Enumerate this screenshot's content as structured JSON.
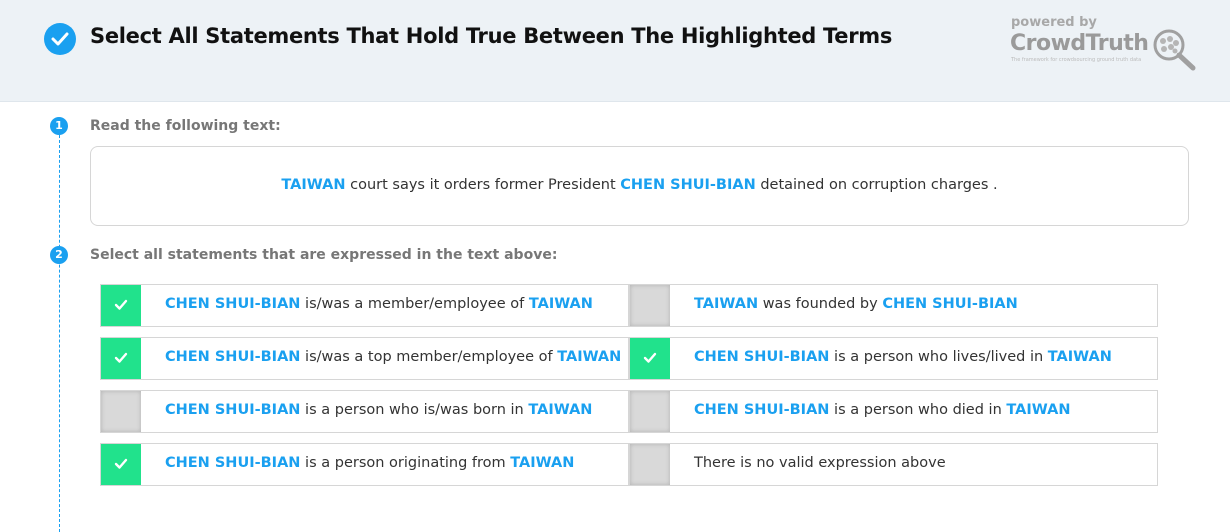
{
  "header": {
    "title": "Select All Statements That Hold True Between The Highlighted Terms",
    "powered_by": "powered by",
    "brand": "CrowdTruth",
    "tagline": "The framework for crowdsourcing ground truth data",
    "accent_color": "#1aa0f0"
  },
  "steps": [
    {
      "number": "1",
      "label": "Read the following text:"
    },
    {
      "number": "2",
      "label": "Select all statements that are expressed in the text above:"
    }
  ],
  "passage": {
    "term1": "TAIWAN",
    "part1": " court says it orders former President ",
    "term2": "CHEN SHUI-BIAN",
    "part2": " detained on corruption charges ."
  },
  "options": [
    {
      "checked": true,
      "a": "CHEN SHUI-BIAN",
      "mid": " is/was a member/employee of ",
      "b": "TAIWAN",
      "plain": ""
    },
    {
      "checked": false,
      "a": "TAIWAN",
      "mid": " was founded by ",
      "b": "CHEN SHUI-BIAN",
      "plain": ""
    },
    {
      "checked": true,
      "a": "CHEN SHUI-BIAN",
      "mid": " is/was a top member/employee of ",
      "b": "TAIWAN",
      "plain": ""
    },
    {
      "checked": true,
      "a": "CHEN SHUI-BIAN",
      "mid": " is a person who lives/lived in ",
      "b": "TAIWAN",
      "plain": ""
    },
    {
      "checked": false,
      "a": "CHEN SHUI-BIAN",
      "mid": " is a person who is/was born in ",
      "b": "TAIWAN",
      "plain": ""
    },
    {
      "checked": false,
      "a": "CHEN SHUI-BIAN",
      "mid": " is a person who died in ",
      "b": "TAIWAN",
      "plain": ""
    },
    {
      "checked": true,
      "a": "CHEN SHUI-BIAN",
      "mid": " is a person originating from ",
      "b": "TAIWAN",
      "plain": ""
    },
    {
      "checked": false,
      "a": "",
      "mid": "",
      "b": "",
      "plain": "There is no valid expression above"
    }
  ],
  "colors": {
    "checked": "#21e28c",
    "unchecked": "#d9d9d9",
    "highlight": "#1aa0f0"
  }
}
